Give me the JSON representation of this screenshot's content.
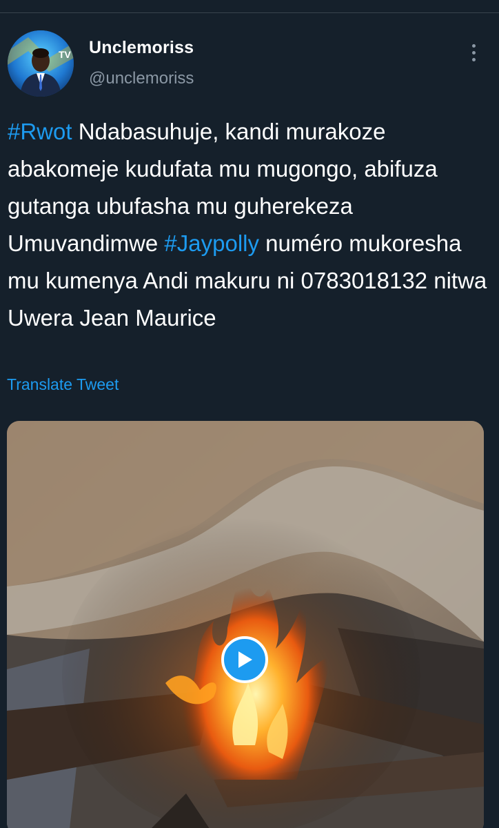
{
  "tweet": {
    "author": {
      "display_name": "Unclemoriss",
      "handle": "@unclemoriss",
      "avatar_icon": "profile-photo",
      "avatar_logo_text": "TV"
    },
    "more_icon": "more-vertical-icon",
    "text_segments": [
      {
        "type": "hashtag",
        "text": "#Rwot"
      },
      {
        "type": "text",
        "text": " Ndabasuhuje, kandi murakoze abakomeje kudufata mu mugongo, abifuza gutanga ubufasha mu guherekeza Umuvandimwe "
      },
      {
        "type": "hashtag",
        "text": "#Jaypolly"
      },
      {
        "type": "text",
        "text": " numéro mukoresha mu kumenya Andi makuru ni  0783018132  nitwa Uwera Jean Maurice"
      }
    ],
    "translate_label": "Translate Tweet",
    "media": {
      "type": "video",
      "play_icon": "play-icon"
    }
  },
  "colors": {
    "background": "#15202b",
    "accent": "#1d9bf0",
    "secondary_text": "#8b98a5"
  }
}
